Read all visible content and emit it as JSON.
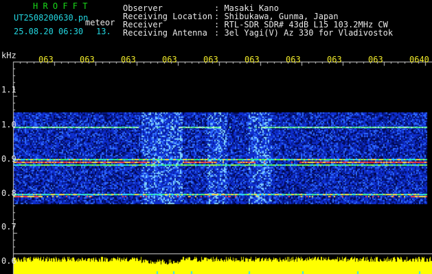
{
  "header": {
    "app_title": "H R O F F T",
    "filename": "UT2508200630.pn",
    "meteor_label": "meteor",
    "datetime": "25.08.20 06:30",
    "value": "13.",
    "info_labels": [
      "Observer",
      "Receiving Location",
      "Receiver",
      "Receiving Antenna"
    ],
    "info_values": [
      ": Masaki Kano",
      ": Shibukawa, Gunma, Japan",
      ": RTL-SDR SDR# 43dB L15 103.2MHz CW",
      ": 3el Yagi(V) Az 330 for Vladivostok"
    ]
  },
  "axis": {
    "unit": "kHz",
    "time_labels": [
      "063",
      "063",
      "063",
      "063",
      "063",
      "063",
      "063",
      "063",
      "063",
      "0640"
    ],
    "freq_labels": [
      "1.1",
      "1.0",
      "0.9",
      "0.8",
      "0.7",
      "0.6"
    ]
  },
  "colors": {
    "background": "#000000",
    "header_green": "#19d819",
    "header_cyan": "#23d6e0",
    "time_label_yellow": "#f0ea2a",
    "spectrum_blue": "#0a2ad8",
    "signal_line": "#ff3030",
    "level_trace": "#ffff00"
  }
}
